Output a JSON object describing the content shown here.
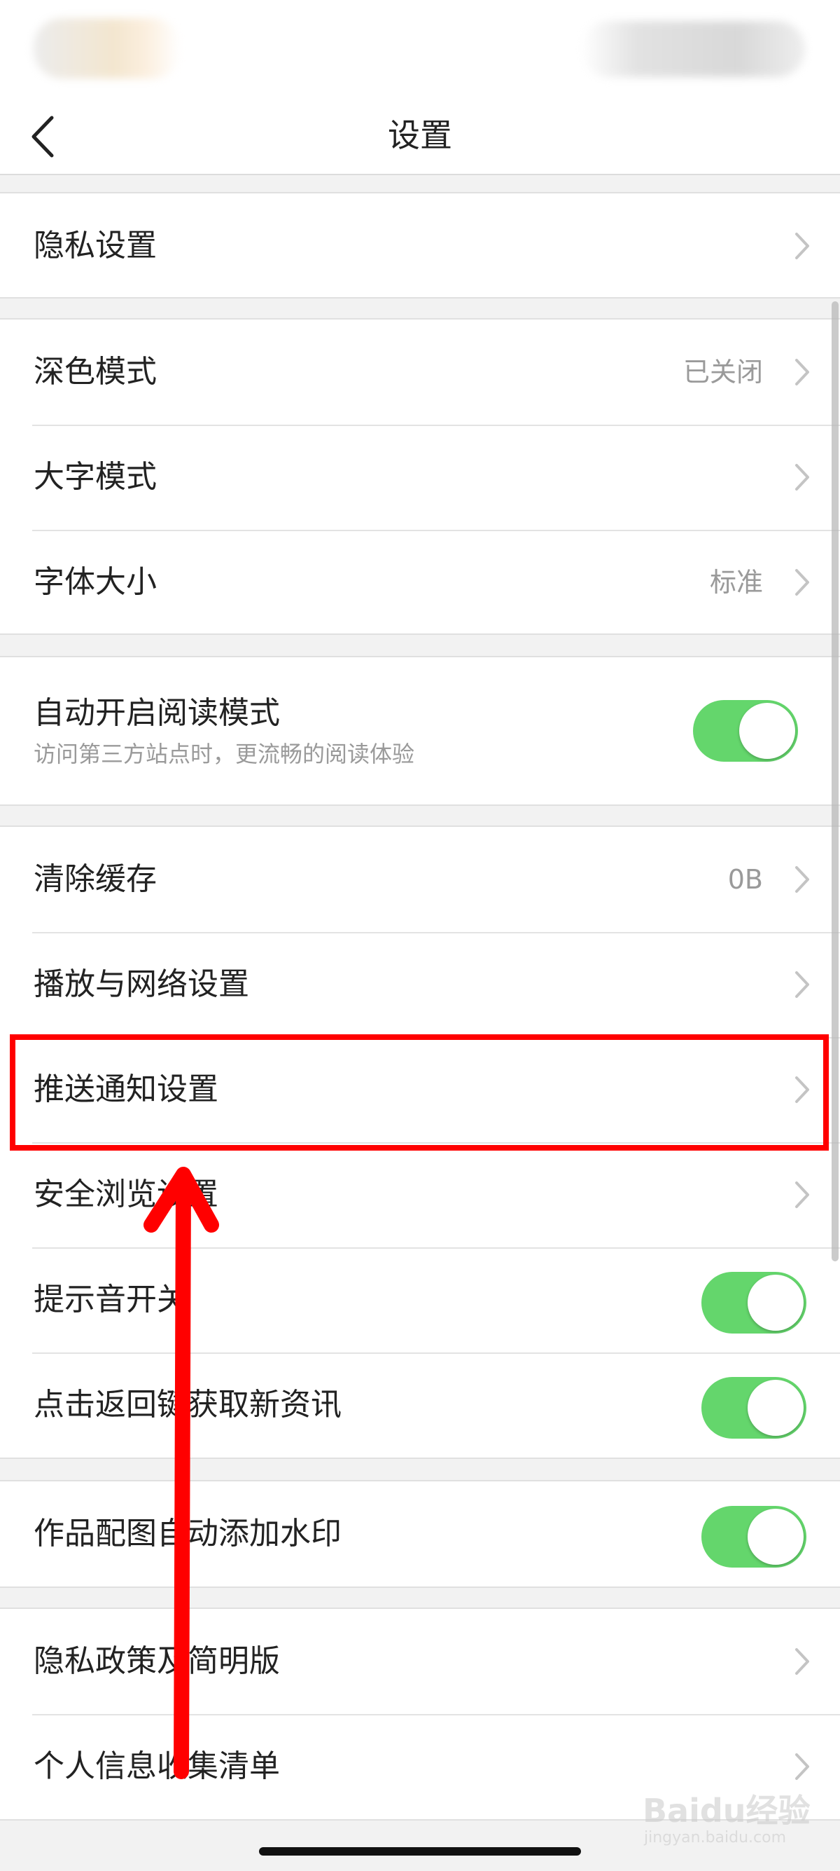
{
  "header": {
    "title": "设置"
  },
  "groups": {
    "privacy": {
      "items": [
        {
          "label": "隐私设置"
        }
      ]
    },
    "display": {
      "items": [
        {
          "label": "深色模式",
          "value": "已关闭"
        },
        {
          "label": "大字模式"
        },
        {
          "label": "字体大小",
          "value": "标准"
        }
      ]
    },
    "reading": {
      "items": [
        {
          "label": "自动开启阅读模式",
          "subtitle": "访问第三方站点时，更流畅的阅读体验",
          "enabled": true
        }
      ]
    },
    "general": {
      "items": [
        {
          "label": "清除缓存",
          "value": "0B"
        },
        {
          "label": "播放与网络设置"
        },
        {
          "label": "推送通知设置"
        },
        {
          "label": "安全浏览设置"
        },
        {
          "label": "提示音开关",
          "enabled": true
        },
        {
          "label": "点击返回键获取新资讯",
          "enabled": true
        }
      ]
    },
    "watermark": {
      "items": [
        {
          "label": "作品配图自动添加水印",
          "enabled": true
        }
      ]
    },
    "legal": {
      "items": [
        {
          "label": "隐私政策及简明版"
        },
        {
          "label": "个人信息收集清单"
        }
      ]
    }
  },
  "annotation": {
    "highlighted_item": "推送通知设置",
    "box_color": "#ff0000",
    "arrow_color": "#ff0000"
  },
  "colors": {
    "toggle_on": "#64d66c",
    "background": "#f2f2f2",
    "value_text": "#9a9a9a"
  },
  "watermark_brand": {
    "main": "Baidu经验",
    "sub": "jingyan.baidu.com"
  }
}
